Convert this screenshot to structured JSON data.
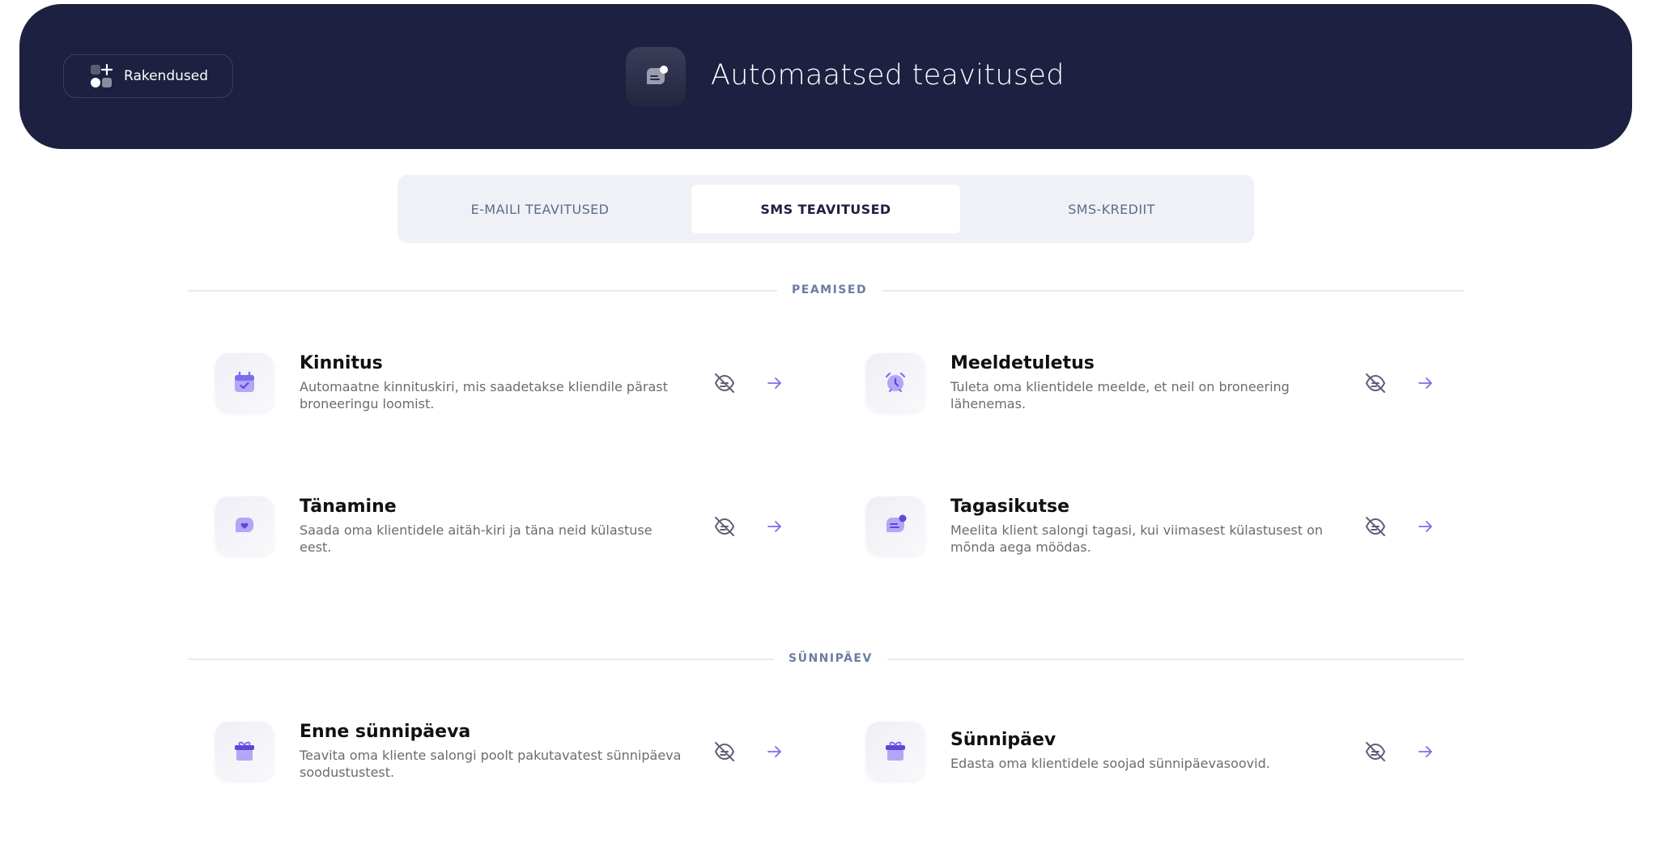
{
  "header": {
    "apps_label": "Rakendused",
    "title": "Automaatsed teavitused",
    "apps_icon": "apps-grid-plus-icon",
    "title_icon": "chat-notification-icon"
  },
  "tabs": [
    {
      "label": "E-MAILI TEAVITUSED",
      "active": false
    },
    {
      "label": "SMS TEAVITUSED",
      "active": true
    },
    {
      "label": "SMS-KREDIIT",
      "active": false
    }
  ],
  "sections": [
    {
      "label": "PEAMISED",
      "cards": [
        {
          "title": "Kinnitus",
          "description": "Automaatne kinnituskiri, mis saadetakse kliendile pärast broneeringu loomist.",
          "icon": "calendar-check-icon"
        },
        {
          "title": "Meeldetuletus",
          "description": "Tuleta oma klientidele meelde, et neil on broneering lähenemas.",
          "icon": "alarm-clock-icon"
        },
        {
          "title": "Tänamine",
          "description": "Saada oma klientidele aitäh-kiri ja täna neid külastuse eest.",
          "icon": "heart-message-icon"
        },
        {
          "title": "Tagasikutse",
          "description": "Meelita klient salongi tagasi, kui viimasest külastusest on mõnda aega möödas.",
          "icon": "message-notification-icon"
        }
      ]
    },
    {
      "label": "SÜNNIPÄEV",
      "cards": [
        {
          "title": "Enne sünnipäeva",
          "description": "Teavita oma kliente salongi poolt pakutavatest sünnipäeva soodustustest.",
          "icon": "gift-icon"
        },
        {
          "title": "Sünnipäev",
          "description": "Edasta oma klientidele soojad sünnipäevasoovid.",
          "icon": "gift-icon"
        }
      ]
    }
  ],
  "colors": {
    "header_bg": "#1d2040",
    "accent": "#7c6cf0",
    "accent_light": "#b2a6f7",
    "muted_text": "#6b6b73"
  },
  "card_actions": {
    "toggle_icon": "eye-off-icon",
    "open_icon": "arrow-right-icon"
  }
}
